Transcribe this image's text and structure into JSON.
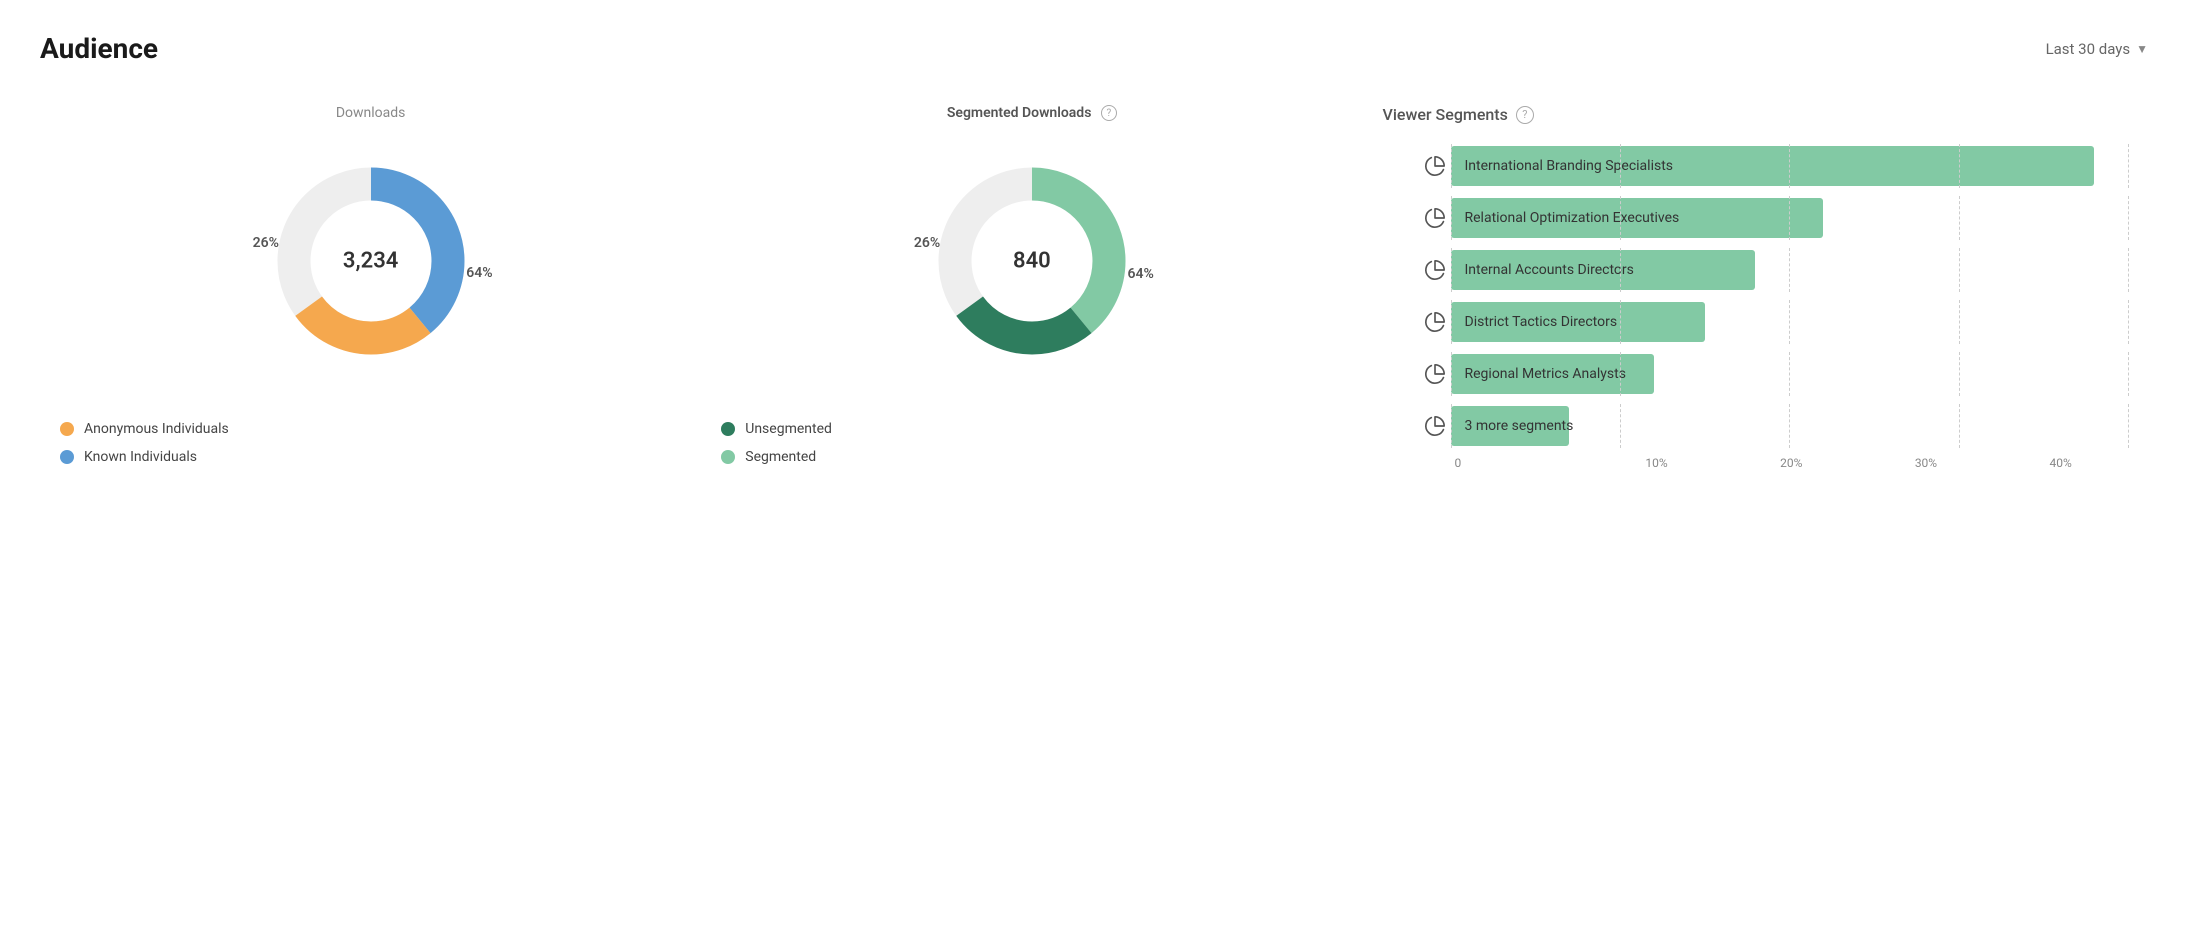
{
  "header": {
    "title": "Audience",
    "date_filter_label": "Last 30 days"
  },
  "downloads_chart": {
    "title": "Downloads",
    "center_value": "3,234",
    "segments": [
      {
        "label": "Anonymous Individuals",
        "percent": 26,
        "color": "#F5A84E"
      },
      {
        "label": "Known Individuals",
        "percent": 64,
        "color": "#5B9BD5"
      }
    ],
    "pct_anonymous": "26%",
    "pct_known": "64%"
  },
  "segmented_chart": {
    "title": "Segmented Downloads",
    "center_value": "840",
    "segments": [
      {
        "label": "Unsegmented",
        "percent": 26,
        "color": "#2E7D5E"
      },
      {
        "label": "Segmented",
        "percent": 64,
        "color": "#82C9A4"
      }
    ],
    "pct_unsegmented": "26%",
    "pct_segmented": "64%"
  },
  "viewer_segments": {
    "title": "Viewer Segments",
    "help_label": "?",
    "bars": [
      {
        "label": "International Branding Specialists",
        "pct": 38,
        "color": "#82C9A4"
      },
      {
        "label": "Relational Optimization Executives",
        "pct": 22,
        "color": "#82C9A4"
      },
      {
        "label": "Internal Accounts Directors",
        "pct": 18,
        "color": "#82C9A4"
      },
      {
        "label": "District Tactics Directors",
        "pct": 15,
        "color": "#82C9A4"
      },
      {
        "label": "Regional Metrics Analysts",
        "pct": 12,
        "color": "#82C9A4"
      },
      {
        "label": "3 more segments",
        "pct": 7,
        "color": "#82C9A4"
      }
    ],
    "x_axis": [
      "0",
      "10%",
      "20%",
      "30%",
      "40%"
    ]
  }
}
